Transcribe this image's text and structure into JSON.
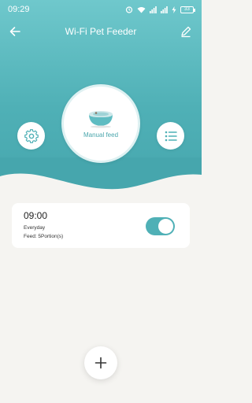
{
  "status_bar": {
    "time": "09:29",
    "battery": "33"
  },
  "appbar": {
    "title": "Wi-Fi Pet Feeder",
    "back_icon": "arrow-left-icon",
    "edit_icon": "pencil-icon"
  },
  "controls": {
    "manual_feed_label": "Manual feed",
    "settings_icon": "gear-icon",
    "list_icon": "list-icon",
    "add_icon": "plus-icon"
  },
  "schedules": [
    {
      "time": "09:00",
      "repeat": "Everyday",
      "portion": "Feed: 5Portion(s)",
      "enabled": true
    }
  ],
  "colors": {
    "accent": "#4fb0b6",
    "hero_top": "#6fc8cc",
    "background": "#f5f4f1"
  }
}
